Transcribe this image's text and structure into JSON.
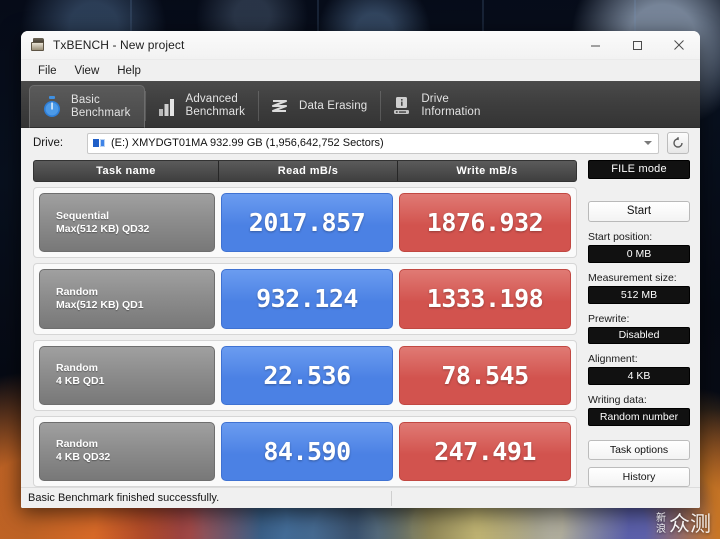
{
  "window": {
    "title": "TxBENCH - New project",
    "app_icon": "txbench-app-icon",
    "controls": {
      "minimize": "minimize-icon",
      "maximize": "maximize-icon",
      "close": "close-icon"
    }
  },
  "menubar": {
    "items": [
      {
        "label": "File"
      },
      {
        "label": "View"
      },
      {
        "label": "Help"
      }
    ]
  },
  "tabs": [
    {
      "label": "Basic\nBenchmark",
      "icon": "stopwatch-icon",
      "active": true
    },
    {
      "label": "Advanced\nBenchmark",
      "icon": "bar-chart-icon",
      "active": false
    },
    {
      "label": "Data Erasing",
      "icon": "wave-icon",
      "active": false
    },
    {
      "label": "Drive\nInformation",
      "icon": "drive-info-icon",
      "active": false
    }
  ],
  "drive": {
    "label": "Drive:",
    "selected": "(E:) XMYDGT01MA  932.99 GB (1,956,642,752 Sectors)",
    "icon": "drive-icon",
    "refresh_icon": "refresh-icon"
  },
  "results": {
    "headers": [
      "Task name",
      "Read mB/s",
      "Write mB/s"
    ],
    "rows": [
      {
        "task_line1": "Sequential",
        "task_line2": "Max(512 KB) QD32",
        "read": "2017.857",
        "write": "1876.932"
      },
      {
        "task_line1": "Random",
        "task_line2": "Max(512 KB) QD1",
        "read": "932.124",
        "write": "1333.198"
      },
      {
        "task_line1": "Random",
        "task_line2": "4 KB QD1",
        "read": "22.536",
        "write": "78.545"
      },
      {
        "task_line1": "Random",
        "task_line2": "4 KB QD32",
        "read": "84.590",
        "write": "247.491"
      }
    ],
    "colors": {
      "read": "#4b81e4",
      "write": "#d2534e"
    }
  },
  "sidebar": {
    "mode": "FILE mode",
    "start_button": "Start",
    "options": [
      {
        "label": "Start position:",
        "value": "0 MB"
      },
      {
        "label": "Measurement size:",
        "value": "512 MB"
      },
      {
        "label": "Prewrite:",
        "value": "Disabled"
      },
      {
        "label": "Alignment:",
        "value": "4 KB"
      },
      {
        "label": "Writing data:",
        "value": "Random number"
      }
    ],
    "task_options_button": "Task options",
    "history_button": "History"
  },
  "statusbar": {
    "message": "Basic Benchmark finished successfully."
  },
  "watermark": {
    "line1": "新",
    "line2": "浪",
    "big": "众测"
  }
}
